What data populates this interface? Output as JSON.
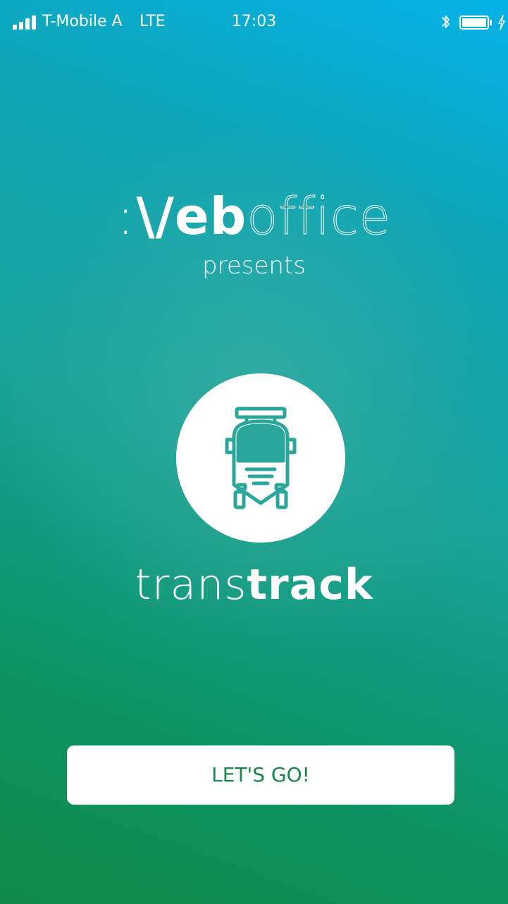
{
  "status_bar": {
    "carrier": "T-Mobile A",
    "network": "LTE",
    "time": "17:03",
    "signal_icon": "signal-bars-icon",
    "bluetooth_icon": "bluetooth-icon",
    "battery_icon": "battery-icon",
    "charging_icon": "charging-bolt-icon"
  },
  "brand": {
    "logo_dots": ":",
    "logo_strong": "\\/eb",
    "logo_light": "office",
    "presents": "presents"
  },
  "product": {
    "icon": "truck-icon",
    "name_light": "trans",
    "name_bold": "track"
  },
  "action": {
    "button_label": "LET'S GO!"
  },
  "colors": {
    "gradient_top": "#04b2e8",
    "gradient_mid": "#18a39a",
    "gradient_bottom": "#0f8a4a",
    "icon_teal": "#2aa79a",
    "button_text": "#14884a"
  }
}
